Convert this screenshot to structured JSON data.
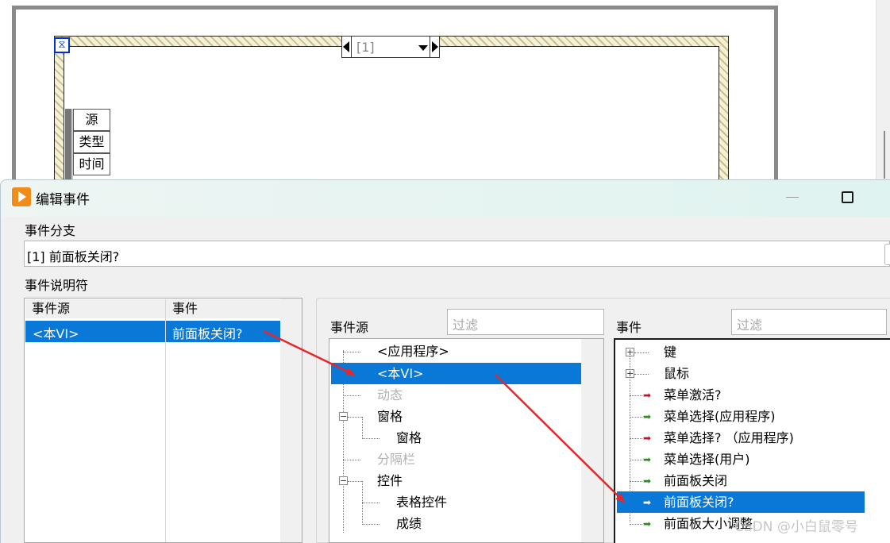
{
  "block_diagram": {
    "case_selector_label": "[1]",
    "event_node_terminals": [
      "源",
      "类型",
      "时间"
    ],
    "hourglass_glyph": "⧖"
  },
  "dialog": {
    "title": "编辑事件",
    "event_case_label": "事件分支",
    "event_case_value": "[1] 前面板关闭?",
    "specifiers_label": "事件说明符",
    "specifiers_table": {
      "headers": [
        "事件源",
        "事件"
      ],
      "rows": [
        [
          "<本VI>",
          "前面板关闭?"
        ]
      ]
    },
    "sources": {
      "label": "事件源",
      "filter_placeholder": "过滤",
      "items": [
        {
          "label": "<应用程序>",
          "state": "normal"
        },
        {
          "label": "<本VI>",
          "state": "selected"
        },
        {
          "label": "动态",
          "state": "disabled"
        },
        {
          "label": "窗格",
          "state": "expanded"
        },
        {
          "label": "窗格",
          "state": "child"
        },
        {
          "label": "分隔栏",
          "state": "disabled"
        },
        {
          "label": "控件",
          "state": "expanded"
        },
        {
          "label": "表格控件",
          "state": "child"
        },
        {
          "label": "成绩",
          "state": "child"
        }
      ]
    },
    "events": {
      "label": "事件",
      "filter_placeholder": "过滤",
      "items": [
        {
          "label": "键",
          "type": "group"
        },
        {
          "label": "鼠标",
          "type": "group"
        },
        {
          "label": "菜单激活?",
          "type": "filter"
        },
        {
          "label": "菜单选择(应用程序)",
          "type": "notify"
        },
        {
          "label": "菜单选择? （应用程序)",
          "type": "filter"
        },
        {
          "label": "菜单选择(用户)",
          "type": "notify"
        },
        {
          "label": "前面板关闭",
          "type": "notify"
        },
        {
          "label": "前面板关闭?",
          "type": "filter",
          "selected": true
        },
        {
          "label": "前面板大小调整",
          "type": "notify"
        }
      ]
    }
  },
  "watermark": "CSDN @小白鼠零号",
  "colors": {
    "selection": "#0a78d7",
    "annotation_arrow": "#e8262a",
    "filter_event_arrow": "#c8102e",
    "notify_event_arrow": "#2e8b1e"
  }
}
